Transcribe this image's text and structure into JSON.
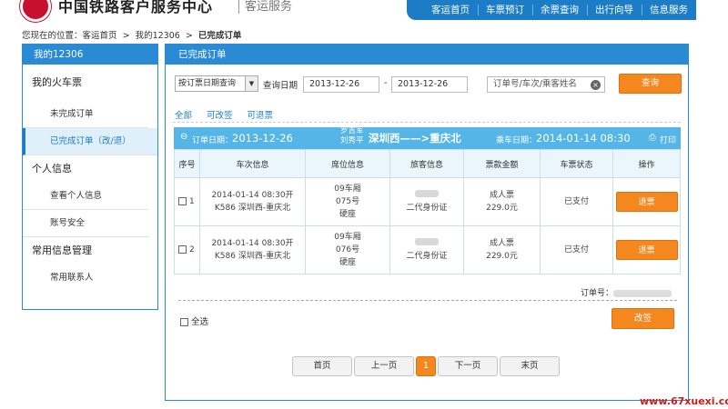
{
  "header": {
    "logo_text": "中国铁路客户服务中心",
    "logo_sub": "客运服务",
    "nav": [
      "客运首页",
      "车票预订",
      "余票查询",
      "出行向导",
      "信息服务"
    ]
  },
  "breadcrumb": {
    "prefix": "您现在的位置：",
    "p1": "客运首页",
    "sep1": "  >  ",
    "p2": "我的12306",
    "sep2": "  >  ",
    "current": "已完成订单"
  },
  "sidebar": {
    "title": "我的12306",
    "sections": [
      {
        "label": "我的火车票",
        "items": [
          {
            "label": "未完成订单"
          },
          {
            "label": "已完成订单（改/退）",
            "active": true
          }
        ]
      },
      {
        "label": "个人信息",
        "items": [
          {
            "label": "查看个人信息"
          },
          {
            "label": "账号安全"
          }
        ]
      },
      {
        "label": "常用信息管理",
        "items": [
          {
            "label": "常用联系人"
          }
        ]
      }
    ]
  },
  "main": {
    "title": "已完成订单",
    "search": {
      "query_type": "按订票日期查询",
      "date_label": "查询日期",
      "start_date": "2013-12-26",
      "range_sep": "-",
      "end_date": "2013-12-26",
      "keyword_placeholder": "订单号/车次/乘客姓名",
      "clear_glyph": "×",
      "query_button": "查询"
    },
    "filter_tabs": [
      "全部",
      "可改签",
      "可退票"
    ],
    "order": {
      "order_date_label": "订单日期：",
      "order_date": "2013-12-26",
      "passengers": [
        "罗吉军",
        "刘秀平"
      ],
      "route": "深圳西——>重庆北",
      "depart_label": "乘车日期：",
      "depart_time": "2014-01-14 08:30",
      "print_label": "打印",
      "columns": [
        "序号",
        "车次信息",
        "席位信息",
        "旅客信息",
        "票款金额",
        "车票状态",
        "操作"
      ],
      "rows": [
        {
          "no": "1",
          "train_line1": "2014-01-14 08:30开",
          "train_line2": "K586 深圳西-重庆北",
          "seat_line1": "09车厢",
          "seat_line2": "075号",
          "seat_line3": "硬座",
          "passenger_id": "二代身份证",
          "ticket_type": "成人票",
          "price": "229.0元",
          "status": "已支付",
          "action": "退票"
        },
        {
          "no": "2",
          "train_line1": "2014-01-14 08:30开",
          "train_line2": "K586 深圳西-重庆北",
          "seat_line1": "09车厢",
          "seat_line2": "076号",
          "seat_line3": "硬座",
          "passenger_id": "二代身份证",
          "ticket_type": "成人票",
          "price": "229.0元",
          "status": "已支付",
          "action": "退票"
        }
      ],
      "order_no_label": "订单号：",
      "select_all": "全选",
      "change_button": "改签"
    },
    "pager": {
      "first": "首页",
      "prev": "上一页",
      "current": "1",
      "next": "下一页",
      "last": "末页"
    }
  },
  "watermark": "www.67xuexi.com",
  "colors": {
    "primary": "#2a8ad4",
    "nav": "#1c7cc6",
    "accent": "#f5871f",
    "order_header": "#54b5e6"
  }
}
